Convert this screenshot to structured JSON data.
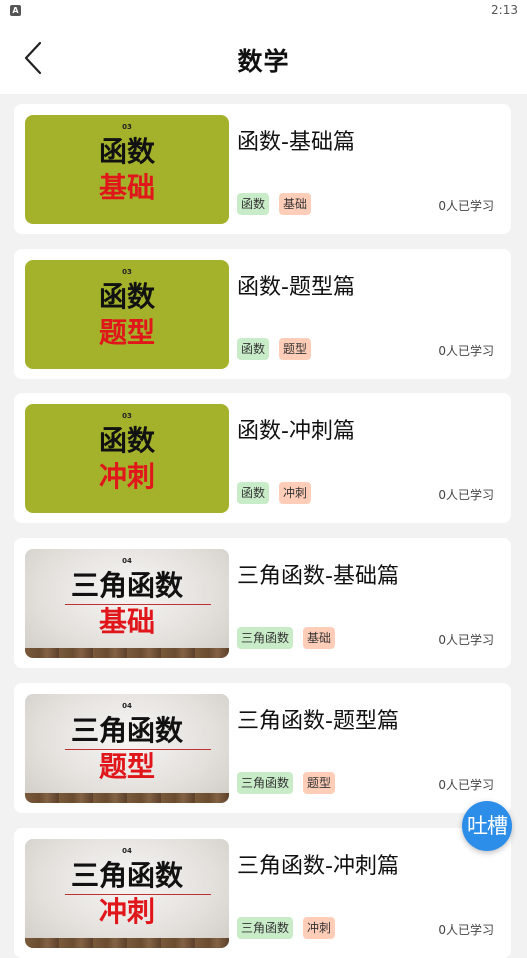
{
  "status_bar": {
    "app_icon": "A",
    "time": "2:13"
  },
  "header": {
    "title": "数学",
    "back_icon": "chevron-left-icon"
  },
  "courses": [
    {
      "thumb_style": "olive",
      "thumb_number": "03",
      "thumb_line1": "函数",
      "thumb_line2": "基础",
      "title": "函数-基础篇",
      "tags": [
        "函数",
        "基础"
      ],
      "learners": "0人已学习"
    },
    {
      "thumb_style": "olive",
      "thumb_number": "03",
      "thumb_line1": "函数",
      "thumb_line2": "题型",
      "title": "函数-题型篇",
      "tags": [
        "函数",
        "题型"
      ],
      "learners": "0人已学习"
    },
    {
      "thumb_style": "olive",
      "thumb_number": "03",
      "thumb_line1": "函数",
      "thumb_line2": "冲刺",
      "title": "函数-冲刺篇",
      "tags": [
        "函数",
        "冲刺"
      ],
      "learners": "0人已学习"
    },
    {
      "thumb_style": "wall",
      "thumb_number": "04",
      "thumb_line1": "三角函数",
      "thumb_line2": "基础",
      "title": "三角函数-基础篇",
      "tags": [
        "三角函数",
        "基础"
      ],
      "learners": "0人已学习"
    },
    {
      "thumb_style": "wall",
      "thumb_number": "04",
      "thumb_line1": "三角函数",
      "thumb_line2": "题型",
      "title": "三角函数-题型篇",
      "tags": [
        "三角函数",
        "题型"
      ],
      "learners": "0人已学习"
    },
    {
      "thumb_style": "wall",
      "thumb_number": "04",
      "thumb_line1": "三角函数",
      "thumb_line2": "冲刺",
      "title": "三角函数-冲刺篇",
      "tags": [
        "三角函数",
        "冲刺"
      ],
      "learners": "0人已学习"
    }
  ],
  "feedback_button": {
    "label": "吐槽"
  },
  "colors": {
    "thumb_olive": "#a4b22b",
    "thumb_red_text": "#e0161a",
    "tag_green": "#c9ecc8",
    "tag_salmon": "#ffcdb8",
    "accent_blue": "#2d8eea"
  }
}
